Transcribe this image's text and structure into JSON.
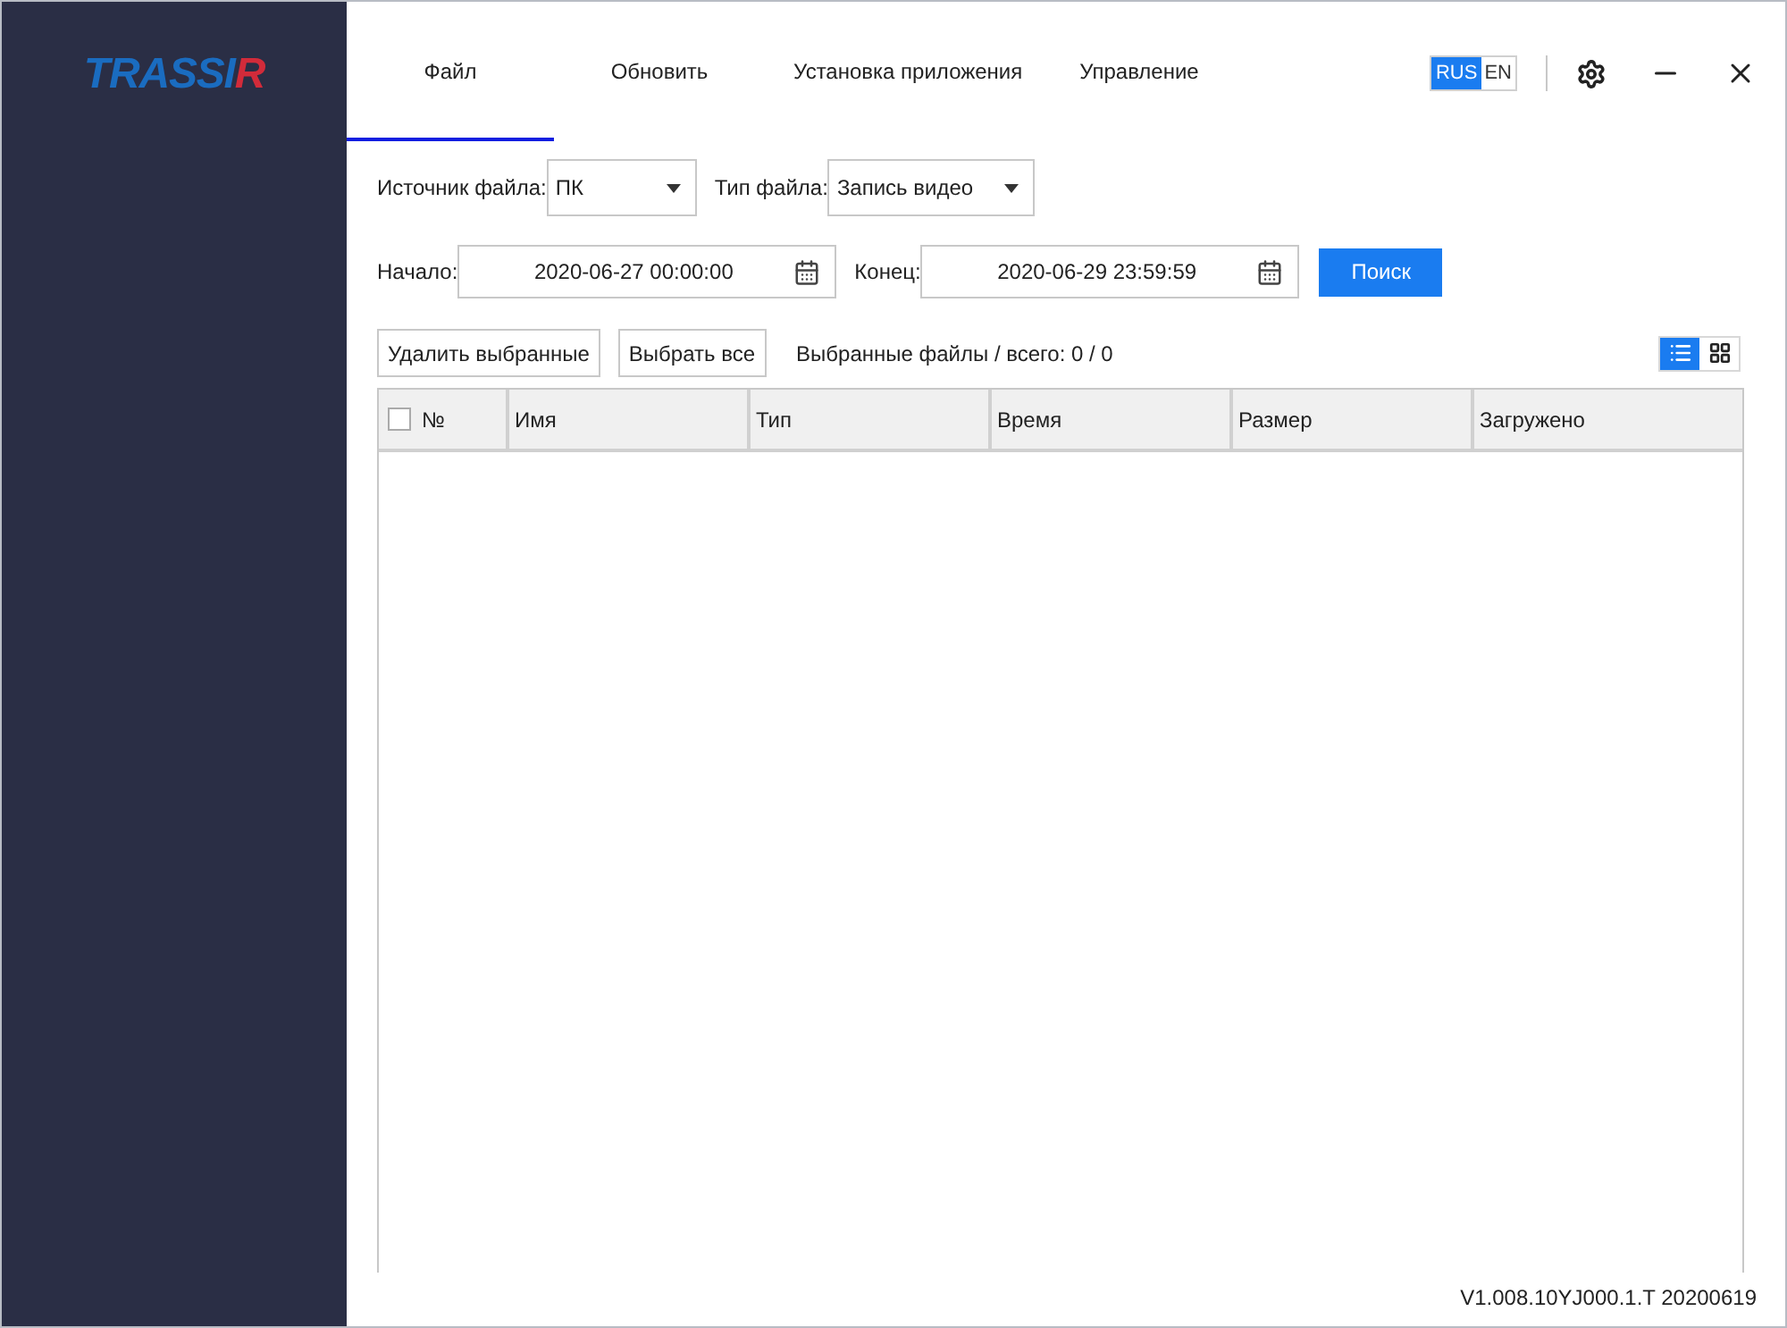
{
  "logo": {
    "main": "TRASSI",
    "accent": "R"
  },
  "tabs": [
    {
      "label": "Файл",
      "selected": true
    },
    {
      "label": "Обновить",
      "selected": false
    },
    {
      "label": "Установка приложения",
      "selected": false
    },
    {
      "label": "Управление",
      "selected": false
    }
  ],
  "languages": [
    {
      "label": "RUS",
      "selected": true
    },
    {
      "label": "EN",
      "selected": false
    }
  ],
  "filters": {
    "source_label": "Источник файла:",
    "source_value": "ПК",
    "type_label": "Тип файла:",
    "type_value": "Запись видео"
  },
  "range": {
    "start_label": "Начало:",
    "start_value": "2020-06-27 00:00:00",
    "end_label": "Конец:",
    "end_value": "2020-06-29 23:59:59",
    "search_button": "Поиск"
  },
  "toolbar": {
    "delete_button": "Удалить выбранные",
    "select_all_button": "Выбрать все",
    "counter": "Выбранные файлы / всего: 0 / 0"
  },
  "views": [
    {
      "kind": "list",
      "selected": true
    },
    {
      "kind": "grid",
      "selected": false
    }
  ],
  "table": {
    "select_all_checked": false,
    "columns": [
      "№",
      "Имя",
      "Тип",
      "Время",
      "Размер",
      "Загружено"
    ]
  },
  "version": "V1.008.10YJ000.1.T 20200619"
}
